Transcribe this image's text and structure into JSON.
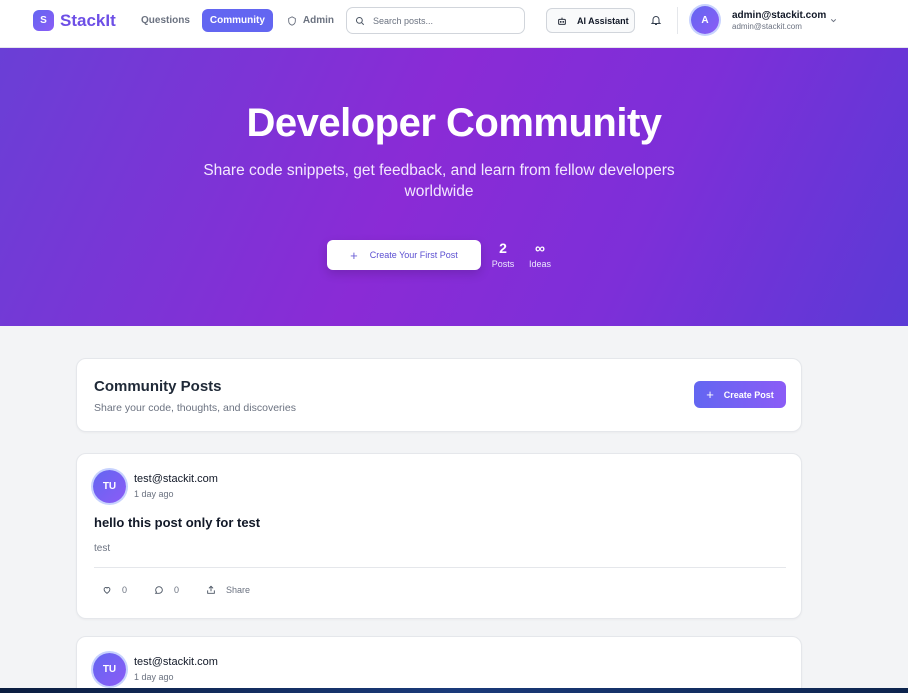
{
  "header": {
    "logo_letter": "S",
    "logo_text": "StackIt",
    "nav": {
      "questions": "Questions",
      "community": "Community",
      "admin": "Admin"
    },
    "search_placeholder": "Search posts...",
    "ai_assistant": "AI Assistant",
    "user": {
      "initial": "A",
      "email": "admin@stackit.com",
      "sub": "admin@stackit.com"
    }
  },
  "hero": {
    "title": "Developer Community",
    "subtitle": "Share code snippets, get feedback, and learn from fellow developers worldwide",
    "cta_label": "Create Your First Post",
    "stats": [
      {
        "value": "2",
        "label": "Posts"
      },
      {
        "value": "∞",
        "label": "Ideas"
      }
    ]
  },
  "posts_section": {
    "title": "Community Posts",
    "subtitle": "Share your code, thoughts, and discoveries",
    "create_label": "Create Post"
  },
  "posts": [
    {
      "initials": "TU",
      "author": "test@stackit.com",
      "time": "1 day ago",
      "title": "hello this post only for test",
      "body": "test",
      "likes": "0",
      "comments": "0",
      "share_label": "Share"
    },
    {
      "initials": "TU",
      "author": "test@stackit.com",
      "time": "1 day ago"
    }
  ],
  "colors": {
    "accent": "#6366f1",
    "brand_text": "#6d4fe6",
    "hero_start": "#6a3fd6",
    "hero_end": "#5b3ad6"
  },
  "icons": [
    "shield-icon",
    "search-icon",
    "robot-icon",
    "bell-icon",
    "chevron-down-icon",
    "plus-icon",
    "heart-icon",
    "comment-icon",
    "share-icon"
  ]
}
